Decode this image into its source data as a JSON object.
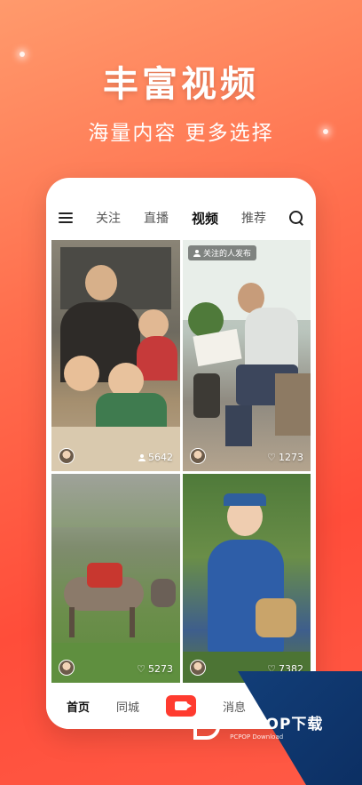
{
  "hero": {
    "title": "丰富视频",
    "subtitle": "海量内容 更多选择"
  },
  "topnav": {
    "tabs": [
      {
        "label": "关注"
      },
      {
        "label": "直播"
      },
      {
        "label": "视频"
      },
      {
        "label": "推荐"
      }
    ]
  },
  "cards": [
    {
      "stat": "5642",
      "stat_icon": "person-icon"
    },
    {
      "badge": "关注的人发布",
      "stat": "1273",
      "stat_icon": "heart-icon"
    },
    {
      "stat": "5273",
      "stat_icon": "heart-icon"
    },
    {
      "stat": "7382",
      "stat_icon": "heart-icon"
    }
  ],
  "bottomnav": {
    "items": [
      {
        "label": "首页"
      },
      {
        "label": "同城"
      },
      {
        "label": "消息"
      }
    ]
  },
  "watermark": {
    "brand": "PCPOP下载",
    "tagline": "PCPOP Download"
  },
  "colors": {
    "accent": "#ff3b2f",
    "background_start": "#ff9a6c",
    "background_end": "#ff4d3a"
  }
}
